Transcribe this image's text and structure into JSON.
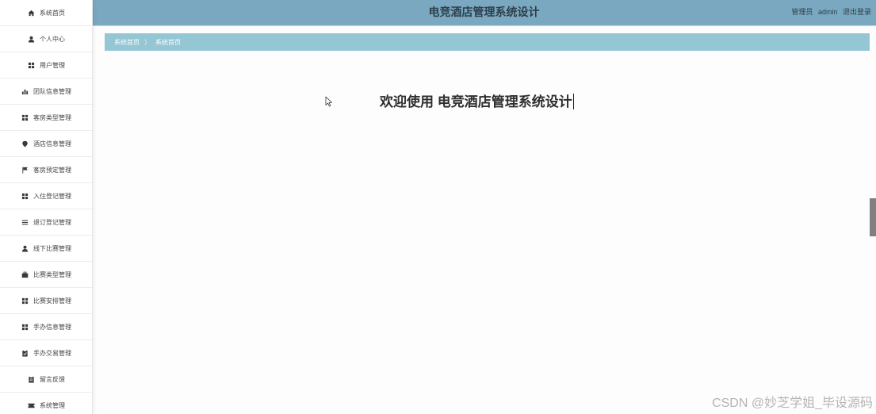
{
  "sidebar": {
    "items": [
      {
        "label": "系统首页",
        "icon": "home-icon"
      },
      {
        "label": "个人中心",
        "icon": "user-icon"
      },
      {
        "label": "用户管理",
        "icon": "grid-icon"
      },
      {
        "label": "团队信息管理",
        "icon": "bar-chart-icon"
      },
      {
        "label": "客房类型管理",
        "icon": "grid-icon"
      },
      {
        "label": "酒店信息管理",
        "icon": "map-pin-icon"
      },
      {
        "label": "客房预定管理",
        "icon": "flag-icon"
      },
      {
        "label": "入住登记管理",
        "icon": "grid-icon"
      },
      {
        "label": "退订登记管理",
        "icon": "list-icon"
      },
      {
        "label": "线下比赛管理",
        "icon": "user-icon"
      },
      {
        "label": "比赛类型管理",
        "icon": "briefcase-icon"
      },
      {
        "label": "比赛安排管理",
        "icon": "grid-icon"
      },
      {
        "label": "手办信息管理",
        "icon": "grid-icon"
      },
      {
        "label": "手办交易管理",
        "icon": "clipboard-check-icon"
      },
      {
        "label": "留言反馈",
        "icon": "clipboard-icon"
      },
      {
        "label": "系统管理",
        "icon": "ticket-icon"
      }
    ]
  },
  "header": {
    "title": "电竞酒店管理系统设计",
    "role": "管理员",
    "username": "admin",
    "logout_label": "退出登录",
    "background_color": "#79a8c0"
  },
  "breadcrumb": {
    "home": "系统首页",
    "separator": "〉",
    "current": "系统首页",
    "background_color": "#94c6d4"
  },
  "main": {
    "welcome_text": "欢迎使用 电竞酒店管理系统设计"
  },
  "watermark": "CSDN @妙芝学姐_毕设源码"
}
